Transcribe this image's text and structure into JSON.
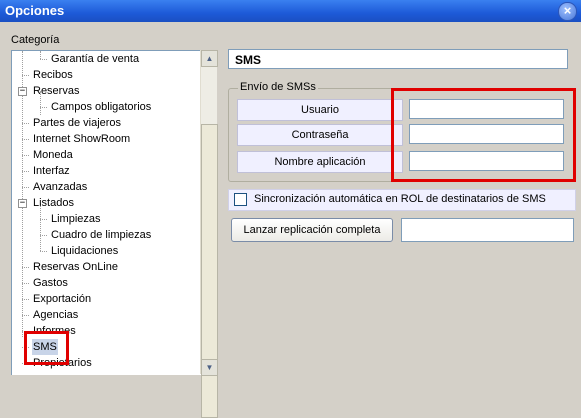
{
  "window": {
    "title": "Opciones",
    "close_icon": "close-icon"
  },
  "category": {
    "label": "Categoría",
    "items": [
      {
        "label": "Garantía de venta"
      },
      {
        "label": "Recibos"
      },
      {
        "label": "Reservas",
        "expander": "−"
      },
      {
        "label": "Campos obligatorios"
      },
      {
        "label": "Partes de viajeros"
      },
      {
        "label": "Internet ShowRoom"
      },
      {
        "label": "Moneda"
      },
      {
        "label": "Interfaz"
      },
      {
        "label": "Avanzadas"
      },
      {
        "label": "Listados",
        "expander": "−"
      },
      {
        "label": "Limpiezas"
      },
      {
        "label": "Cuadro de limpiezas"
      },
      {
        "label": "Liquidaciones"
      },
      {
        "label": "Reservas OnLine"
      },
      {
        "label": "Gastos"
      },
      {
        "label": "Exportación"
      },
      {
        "label": "Agencias"
      },
      {
        "label": "Informes"
      },
      {
        "label": "SMS"
      },
      {
        "label": "Propietarios"
      }
    ],
    "selected": "SMS"
  },
  "panel": {
    "title": "SMS",
    "group_title": "Envío de SMSs",
    "fields": [
      {
        "label": "Usuario",
        "value": ""
      },
      {
        "label": "Contraseña",
        "value": ""
      },
      {
        "label": "Nombre aplicación",
        "value": ""
      }
    ],
    "sync_label": "Sincronización automática en ROL de destinatarios de SMS",
    "sync_checked": false,
    "replicate_button": "Lanzar replicación completa",
    "replicate_value": ""
  },
  "colors": {
    "titlebar": "#1d5ad8",
    "highlight": "#e00000",
    "selection": "#c8d4e8"
  }
}
